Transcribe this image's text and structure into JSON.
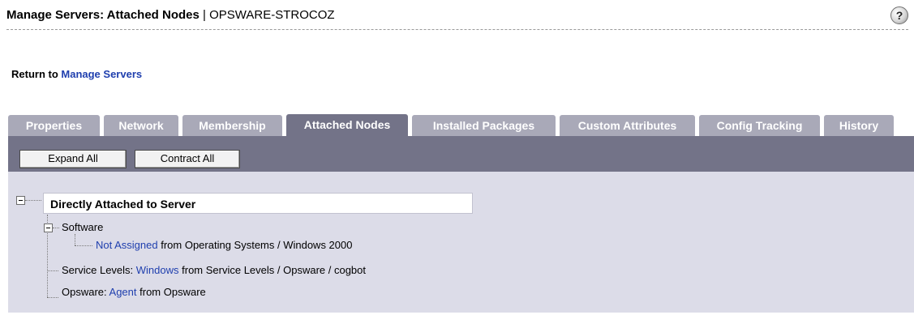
{
  "header": {
    "title_bold": "Manage Servers: Attached Nodes",
    "separator": " | ",
    "server_name": "OPSWARE-STROCOZ",
    "help_glyph": "?"
  },
  "return_nav": {
    "prefix": "Return to ",
    "link": "Manage Servers"
  },
  "tabs": [
    {
      "label": "Properties",
      "active": false
    },
    {
      "label": "Network",
      "active": false
    },
    {
      "label": "Membership",
      "active": false
    },
    {
      "label": "Attached Nodes",
      "active": true
    },
    {
      "label": "Installed Packages",
      "active": false
    },
    {
      "label": "Custom Attributes",
      "active": false
    },
    {
      "label": "Config Tracking",
      "active": false
    },
    {
      "label": "History",
      "active": false
    }
  ],
  "toolbar": {
    "expand_all": "Expand All",
    "contract_all": "Contract All"
  },
  "tree": {
    "root_label": "Directly Attached to Server",
    "software": {
      "label": "Software",
      "item": {
        "link": "Not Assigned",
        "suffix": " from Operating Systems / Windows 2000"
      }
    },
    "service_levels": {
      "prefix": "Service Levels: ",
      "link": "Windows",
      "suffix": " from Service Levels / Opsware / cogbot"
    },
    "opsware": {
      "prefix": "Opsware: ",
      "link": "Agent",
      "suffix": " from Opsware"
    }
  },
  "colors": {
    "tab_inactive": "#a9a9b8",
    "tab_active": "#737388",
    "toolbar": "#737388",
    "panel": "#dcdce8",
    "link": "#1f3fae"
  }
}
